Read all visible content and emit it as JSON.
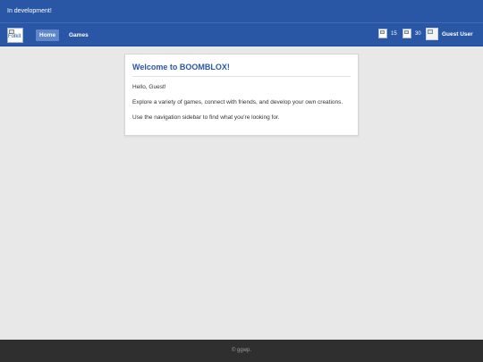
{
  "dev_banner": {
    "text": "In development!"
  },
  "navbar": {
    "logo_alt": "Folkit",
    "links": [
      {
        "label": "Home",
        "active": true
      },
      {
        "label": "Games",
        "active": false
      }
    ],
    "stats": [
      {
        "icon": "broken-image-icon",
        "value": "15"
      },
      {
        "icon": "broken-image-icon",
        "value": "30"
      }
    ],
    "avatar_icon": "user-avatar-icon",
    "username": "Guest User"
  },
  "welcome_card": {
    "title": "Welcome to BOOMBLOX!",
    "greeting": "Hello, Guest!",
    "description": "Explore a variety of games, connect with friends, and develop your own creations.",
    "instruction": "Use the navigation sidebar to find what you're looking for."
  },
  "footer": {
    "text": "© ggwp."
  },
  "colors": {
    "brand_blue": "#2a57a5",
    "active_tab": "#5f86c8",
    "page_bg": "#e8e8e8",
    "footer_bg": "#2f2f2f"
  }
}
